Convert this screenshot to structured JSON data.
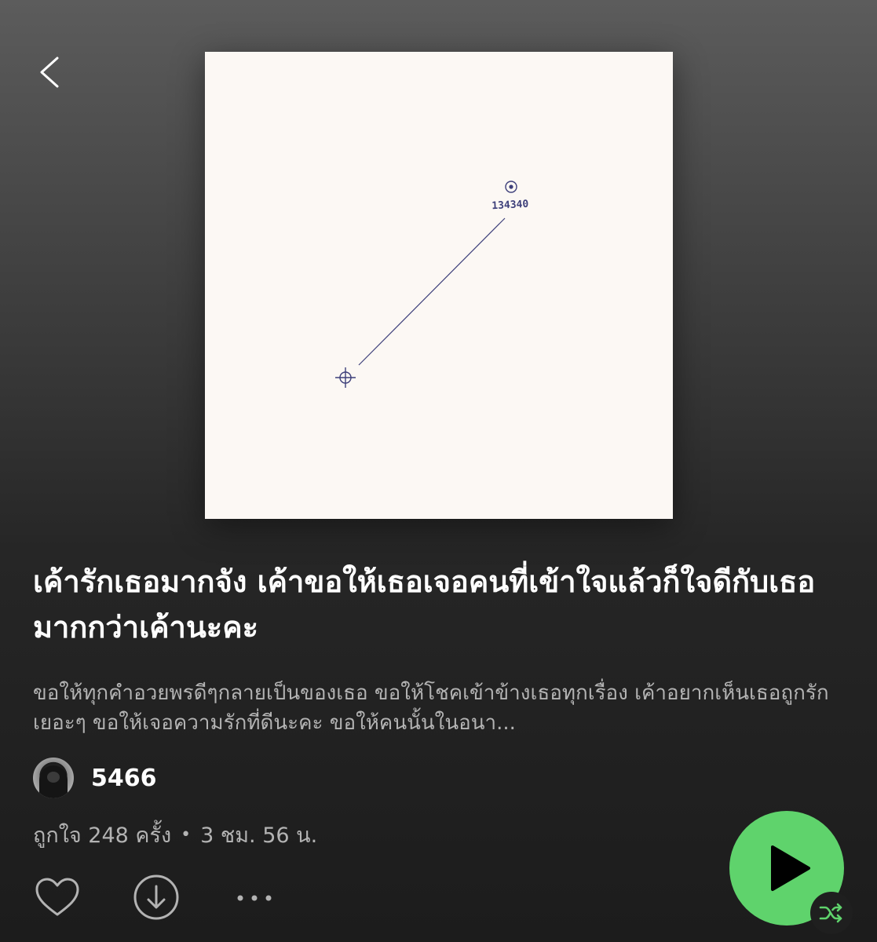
{
  "header": {
    "back_icon": "chevron-left-icon"
  },
  "cover": {
    "label": "134340",
    "ink_color": "#3d3f7a",
    "background": "#fcf8f4"
  },
  "playlist": {
    "title": "เค้ารักเธอมากจัง เค้าขอให้เธอเจอคนที่เข้าใจแล้วก็ใจดีกับเธอมากกว่าเค้านะคะ",
    "description": "ขอให้ทุกคำอวยพรดีๆกลายเป็นของเธอ ขอให้โชคเข้าข้างเธอทุกเรื่อง เค้าอยากเห็นเธอถูกรักเยอะๆ ขอให้เจอความรักที่ดีนะคะ ขอให้คนนั้นในอนา...",
    "owner": "5466",
    "likes": "ถูกใจ 248 ครั้ง",
    "separator": "•",
    "duration": "3 ชม. 56 น."
  },
  "actions": {
    "like_icon": "heart-icon",
    "download_icon": "download-icon",
    "more_icon": "more-icon",
    "play_icon": "play-icon",
    "shuffle_icon": "shuffle-icon"
  },
  "colors": {
    "accent": "#5fd36c",
    "text_primary": "#ffffff",
    "text_secondary": "#b3b3b3"
  }
}
